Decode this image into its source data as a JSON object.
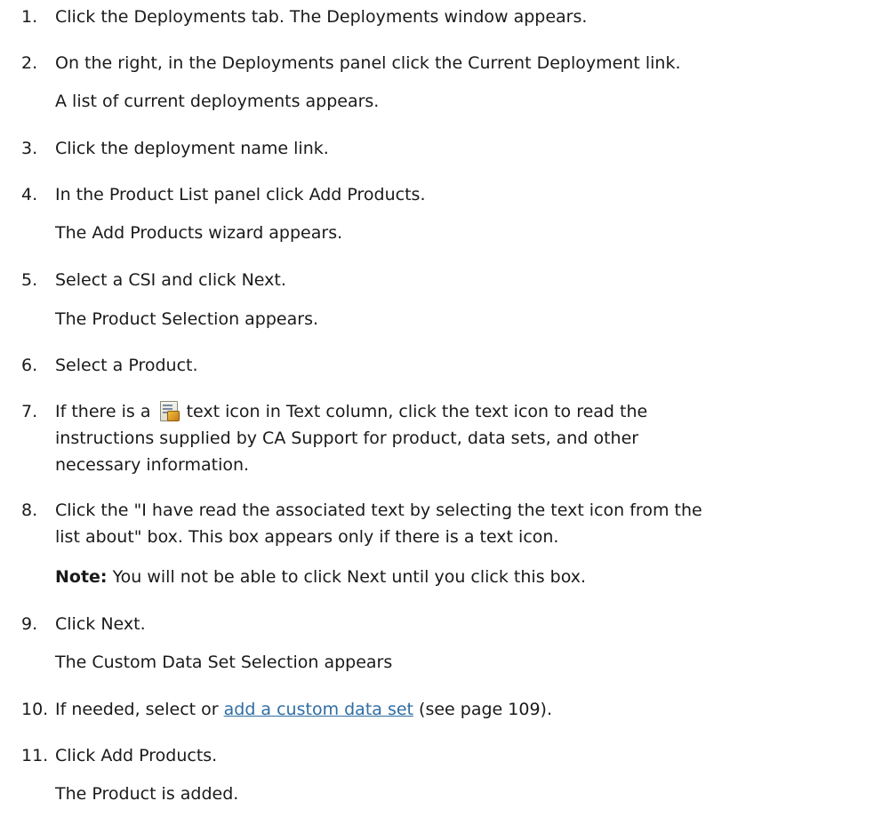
{
  "steps": [
    {
      "num": "1.",
      "text": "Click the Deployments tab. The Deployments window appears."
    },
    {
      "num": "2.",
      "text": "On the right, in the Deployments panel click the Current Deployment link.",
      "sub": "A list of current deployments appears."
    },
    {
      "num": "3.",
      "text": "Click the deployment name link."
    },
    {
      "num": "4.",
      "text": "In the Product List panel click Add Products.",
      "sub": "The Add Products wizard appears."
    },
    {
      "num": "5.",
      "text": "Select a CSI and click Next.",
      "sub": "The Product Selection appears."
    },
    {
      "num": "6.",
      "text": "Select a Product."
    },
    {
      "num": "7.",
      "text_before": "If there is a",
      "text_after": "text icon in Text column, click the text icon to read the",
      "line2": "instructions supplied by CA Support for product, data sets, and other",
      "line3": "necessary information.",
      "icon": "text-document-icon"
    },
    {
      "num": "8.",
      "text": "Click the \"I have read the associated text by selecting the text icon from the",
      "line2": "list about\" box. This box appears only if there is a text icon.",
      "note_label": "Note:",
      "note_text": "You will not be able to click Next until you click this box."
    },
    {
      "num": "9.",
      "text": "Click Next.",
      "sub": "The Custom Data Set Selection appears"
    },
    {
      "num": "10.",
      "text_before": "If needed, select or",
      "link": "add a custom data set",
      "text_after": "(see page 109)."
    },
    {
      "num": "11.",
      "text": "Click Add Products.",
      "sub": "The Product is added."
    }
  ],
  "colors": {
    "text": "#1a1a1a",
    "link": "#2f6da3"
  }
}
